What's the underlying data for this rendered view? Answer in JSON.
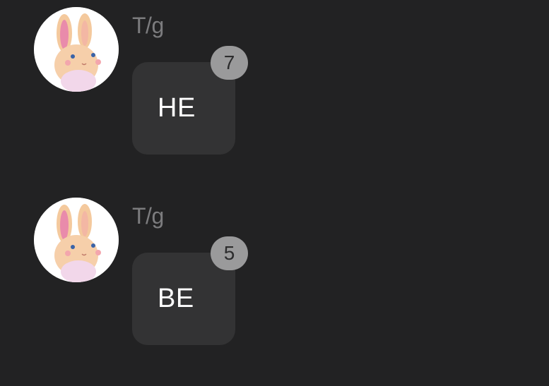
{
  "colors": {
    "background": "#222223",
    "bubble": "#333334",
    "badge": "#9a9a9b",
    "sender_text": "#7c7c7e",
    "message_text": "#ffffff"
  },
  "messages": [
    {
      "avatar_icon": "bunny-avatar-icon",
      "sender": "T/g",
      "text": "HE",
      "badge_count": "7"
    },
    {
      "avatar_icon": "bunny-avatar-icon",
      "sender": "T/g",
      "text": "BE",
      "badge_count": "5"
    }
  ]
}
